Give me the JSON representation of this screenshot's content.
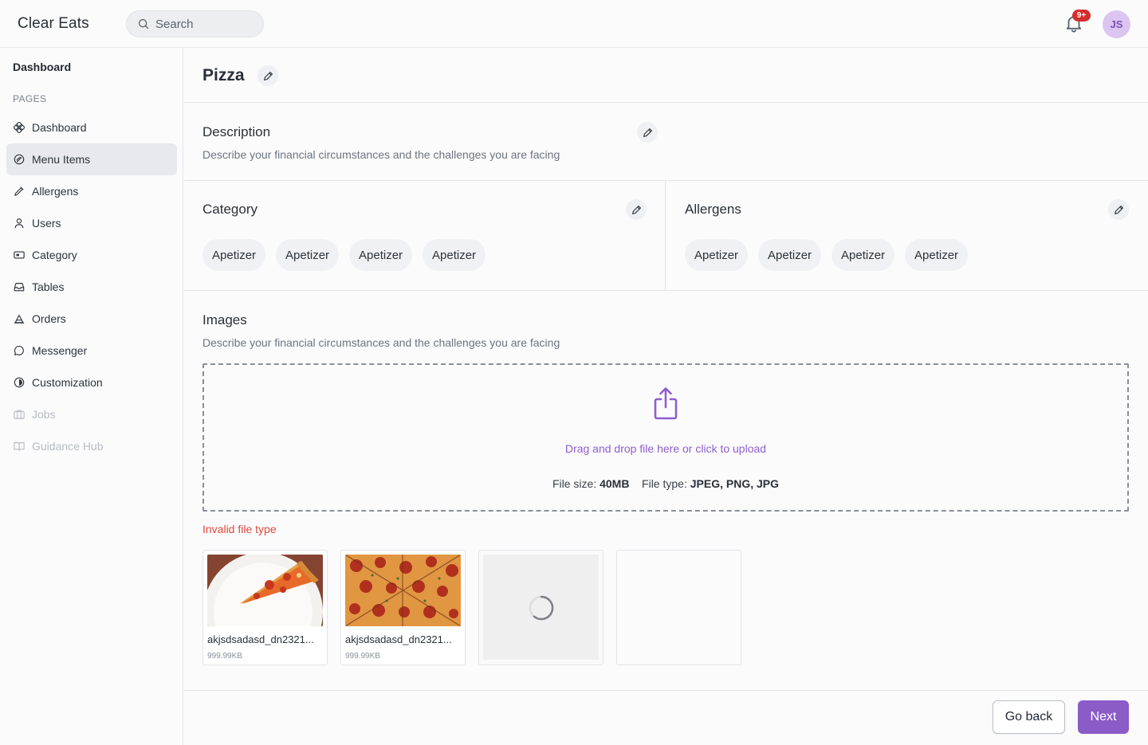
{
  "app": {
    "name": "Clear Eats",
    "search_placeholder": "Search",
    "notifications_badge": "9+",
    "avatar_initials": "JS"
  },
  "sidebar": {
    "title": "Dashboard",
    "section_label": "PAGES",
    "items": [
      {
        "label": "Dashboard",
        "icon": "dashboard-icon",
        "state": "normal"
      },
      {
        "label": "Menu Items",
        "icon": "menu-items-icon",
        "state": "active"
      },
      {
        "label": "Allergens",
        "icon": "allergens-icon",
        "state": "normal"
      },
      {
        "label": "Users",
        "icon": "users-icon",
        "state": "normal"
      },
      {
        "label": "Category",
        "icon": "category-icon",
        "state": "normal"
      },
      {
        "label": "Tables",
        "icon": "tables-icon",
        "state": "normal"
      },
      {
        "label": "Orders",
        "icon": "orders-icon",
        "state": "normal"
      },
      {
        "label": "Messenger",
        "icon": "messenger-icon",
        "state": "normal"
      },
      {
        "label": "Customization",
        "icon": "customization-icon",
        "state": "normal"
      },
      {
        "label": "Jobs",
        "icon": "jobs-icon",
        "state": "disabled"
      },
      {
        "label": "Guidance Hub",
        "icon": "guidance-hub-icon",
        "state": "disabled"
      }
    ]
  },
  "item": {
    "title": "Pizza",
    "description": {
      "title": "Description",
      "text": "Describe your financial circumstances and the challenges you are facing"
    },
    "category": {
      "title": "Category",
      "chips": [
        "Apetizer",
        "Apetizer",
        "Apetizer",
        "Apetizer"
      ]
    },
    "allergens": {
      "title": "Allergens",
      "chips": [
        "Apetizer",
        "Apetizer",
        "Apetizer",
        "Apetizer"
      ]
    },
    "images": {
      "title": "Images",
      "description": "Describe your financial circumstances and the challenges you are facing",
      "dropzone": {
        "prompt": "Drag and drop file here or click to upload",
        "size_label": "File size:",
        "size_value": "40MB",
        "type_label": "File type:",
        "type_value": "JPEG, PNG, JPG"
      },
      "error": "Invalid file type",
      "files": [
        {
          "name": "akjsdsadasd_dn2321...",
          "size": "999.99KB",
          "status": "uploaded"
        },
        {
          "name": "akjsdsadasd_dn2321...",
          "size": "999.99KB",
          "status": "uploaded"
        },
        {
          "status": "loading"
        },
        {
          "status": "empty"
        }
      ]
    }
  },
  "footer": {
    "back_label": "Go back",
    "next_label": "Next"
  },
  "colors": {
    "accent": "#8b5bc8",
    "error": "#e0483b",
    "badge": "#d42d2d",
    "avatar_bg": "#dcc6f1"
  }
}
